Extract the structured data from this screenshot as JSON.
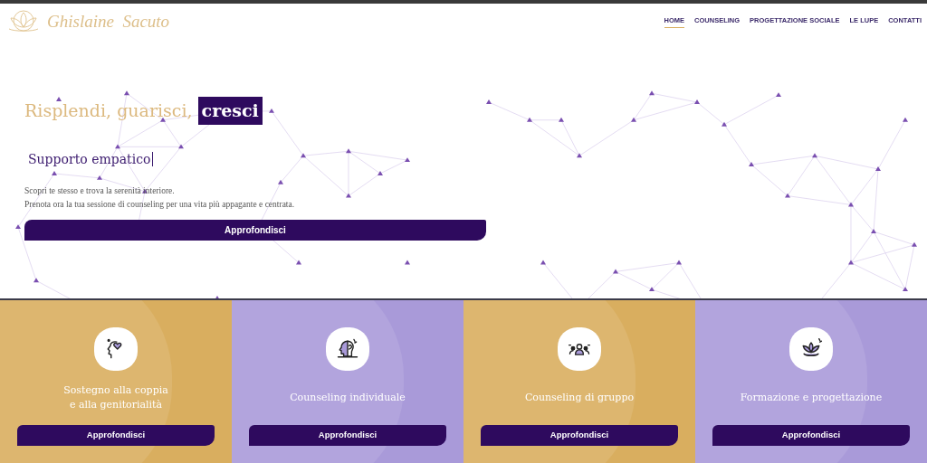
{
  "header": {
    "logo_text": "Ghislaine  Sacuto",
    "nav": [
      {
        "label": "HOME",
        "selected": true
      },
      {
        "label": "COUNSELING",
        "selected": false
      },
      {
        "label": "PROGETTAZIONE SOCIALE",
        "selected": false
      },
      {
        "label": "LE LUPE",
        "selected": false
      },
      {
        "label": "CONTATTI",
        "selected": false
      }
    ]
  },
  "hero": {
    "title": "Risplendi, guarisci,",
    "title_highlight": "cresci",
    "subtitle": "Supporto empatico",
    "text_lines": [
      "Scopri te stesso e trova la serenità interiore.",
      "Prenota ora la tua sessione di counseling per una vita più appagante e centrata."
    ],
    "button": "Approfondisci"
  },
  "services": [
    {
      "kind": "couple",
      "color": "#d9ae5f",
      "title_lines": [
        "Sostegno alla coppia",
        "e alla genitorialità"
      ],
      "button": "Approfondisci"
    },
    {
      "kind": "individual",
      "color": "#a99ad9",
      "title_lines": [
        "Counseling individuale"
      ],
      "button": "Approfondisci"
    },
    {
      "kind": "group",
      "color": "#d9ae5f",
      "title_lines": [
        "Counseling di gruppo"
      ],
      "button": "Approfondisci"
    },
    {
      "kind": "lotus",
      "color": "#a99ad9",
      "title_lines": [
        "Formazione e progettazione"
      ],
      "button": "Approfondisci"
    }
  ]
}
